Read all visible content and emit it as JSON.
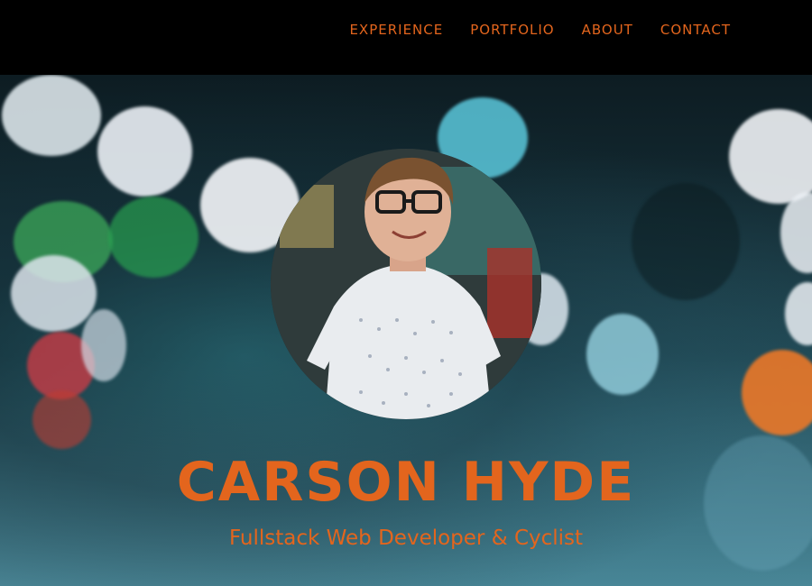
{
  "nav": {
    "items": [
      {
        "label": "EXPERIENCE"
      },
      {
        "label": "PORTFOLIO"
      },
      {
        "label": "ABOUT"
      },
      {
        "label": "CONTACT"
      }
    ]
  },
  "hero": {
    "name": "CARSON HYDE",
    "tagline": "Fullstack Web Developer & Cyclist",
    "profile_image": "profile-photo",
    "background_image": "bokeh-lights"
  },
  "colors": {
    "accent": "#e3651d",
    "nav_bg": "#000000"
  }
}
